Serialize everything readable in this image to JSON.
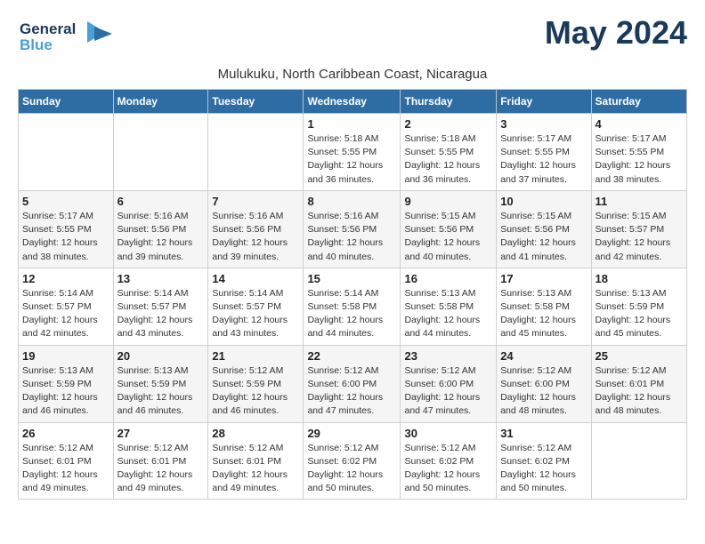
{
  "header": {
    "logo_line1": "General",
    "logo_line2": "Blue",
    "title": "May 2024",
    "subtitle": "Mulukuku, North Caribbean Coast, Nicaragua"
  },
  "weekdays": [
    "Sunday",
    "Monday",
    "Tuesday",
    "Wednesday",
    "Thursday",
    "Friday",
    "Saturday"
  ],
  "weeks": [
    [
      {
        "day": "",
        "info": ""
      },
      {
        "day": "",
        "info": ""
      },
      {
        "day": "",
        "info": ""
      },
      {
        "day": "1",
        "info": "Sunrise: 5:18 AM\nSunset: 5:55 PM\nDaylight: 12 hours\nand 36 minutes."
      },
      {
        "day": "2",
        "info": "Sunrise: 5:18 AM\nSunset: 5:55 PM\nDaylight: 12 hours\nand 36 minutes."
      },
      {
        "day": "3",
        "info": "Sunrise: 5:17 AM\nSunset: 5:55 PM\nDaylight: 12 hours\nand 37 minutes."
      },
      {
        "day": "4",
        "info": "Sunrise: 5:17 AM\nSunset: 5:55 PM\nDaylight: 12 hours\nand 38 minutes."
      }
    ],
    [
      {
        "day": "5",
        "info": "Sunrise: 5:17 AM\nSunset: 5:55 PM\nDaylight: 12 hours\nand 38 minutes."
      },
      {
        "day": "6",
        "info": "Sunrise: 5:16 AM\nSunset: 5:56 PM\nDaylight: 12 hours\nand 39 minutes."
      },
      {
        "day": "7",
        "info": "Sunrise: 5:16 AM\nSunset: 5:56 PM\nDaylight: 12 hours\nand 39 minutes."
      },
      {
        "day": "8",
        "info": "Sunrise: 5:16 AM\nSunset: 5:56 PM\nDaylight: 12 hours\nand 40 minutes."
      },
      {
        "day": "9",
        "info": "Sunrise: 5:15 AM\nSunset: 5:56 PM\nDaylight: 12 hours\nand 40 minutes."
      },
      {
        "day": "10",
        "info": "Sunrise: 5:15 AM\nSunset: 5:56 PM\nDaylight: 12 hours\nand 41 minutes."
      },
      {
        "day": "11",
        "info": "Sunrise: 5:15 AM\nSunset: 5:57 PM\nDaylight: 12 hours\nand 42 minutes."
      }
    ],
    [
      {
        "day": "12",
        "info": "Sunrise: 5:14 AM\nSunset: 5:57 PM\nDaylight: 12 hours\nand 42 minutes."
      },
      {
        "day": "13",
        "info": "Sunrise: 5:14 AM\nSunset: 5:57 PM\nDaylight: 12 hours\nand 43 minutes."
      },
      {
        "day": "14",
        "info": "Sunrise: 5:14 AM\nSunset: 5:57 PM\nDaylight: 12 hours\nand 43 minutes."
      },
      {
        "day": "15",
        "info": "Sunrise: 5:14 AM\nSunset: 5:58 PM\nDaylight: 12 hours\nand 44 minutes."
      },
      {
        "day": "16",
        "info": "Sunrise: 5:13 AM\nSunset: 5:58 PM\nDaylight: 12 hours\nand 44 minutes."
      },
      {
        "day": "17",
        "info": "Sunrise: 5:13 AM\nSunset: 5:58 PM\nDaylight: 12 hours\nand 45 minutes."
      },
      {
        "day": "18",
        "info": "Sunrise: 5:13 AM\nSunset: 5:59 PM\nDaylight: 12 hours\nand 45 minutes."
      }
    ],
    [
      {
        "day": "19",
        "info": "Sunrise: 5:13 AM\nSunset: 5:59 PM\nDaylight: 12 hours\nand 46 minutes."
      },
      {
        "day": "20",
        "info": "Sunrise: 5:13 AM\nSunset: 5:59 PM\nDaylight: 12 hours\nand 46 minutes."
      },
      {
        "day": "21",
        "info": "Sunrise: 5:12 AM\nSunset: 5:59 PM\nDaylight: 12 hours\nand 46 minutes."
      },
      {
        "day": "22",
        "info": "Sunrise: 5:12 AM\nSunset: 6:00 PM\nDaylight: 12 hours\nand 47 minutes."
      },
      {
        "day": "23",
        "info": "Sunrise: 5:12 AM\nSunset: 6:00 PM\nDaylight: 12 hours\nand 47 minutes."
      },
      {
        "day": "24",
        "info": "Sunrise: 5:12 AM\nSunset: 6:00 PM\nDaylight: 12 hours\nand 48 minutes."
      },
      {
        "day": "25",
        "info": "Sunrise: 5:12 AM\nSunset: 6:01 PM\nDaylight: 12 hours\nand 48 minutes."
      }
    ],
    [
      {
        "day": "26",
        "info": "Sunrise: 5:12 AM\nSunset: 6:01 PM\nDaylight: 12 hours\nand 49 minutes."
      },
      {
        "day": "27",
        "info": "Sunrise: 5:12 AM\nSunset: 6:01 PM\nDaylight: 12 hours\nand 49 minutes."
      },
      {
        "day": "28",
        "info": "Sunrise: 5:12 AM\nSunset: 6:01 PM\nDaylight: 12 hours\nand 49 minutes."
      },
      {
        "day": "29",
        "info": "Sunrise: 5:12 AM\nSunset: 6:02 PM\nDaylight: 12 hours\nand 50 minutes."
      },
      {
        "day": "30",
        "info": "Sunrise: 5:12 AM\nSunset: 6:02 PM\nDaylight: 12 hours\nand 50 minutes."
      },
      {
        "day": "31",
        "info": "Sunrise: 5:12 AM\nSunset: 6:02 PM\nDaylight: 12 hours\nand 50 minutes."
      },
      {
        "day": "",
        "info": ""
      }
    ]
  ]
}
